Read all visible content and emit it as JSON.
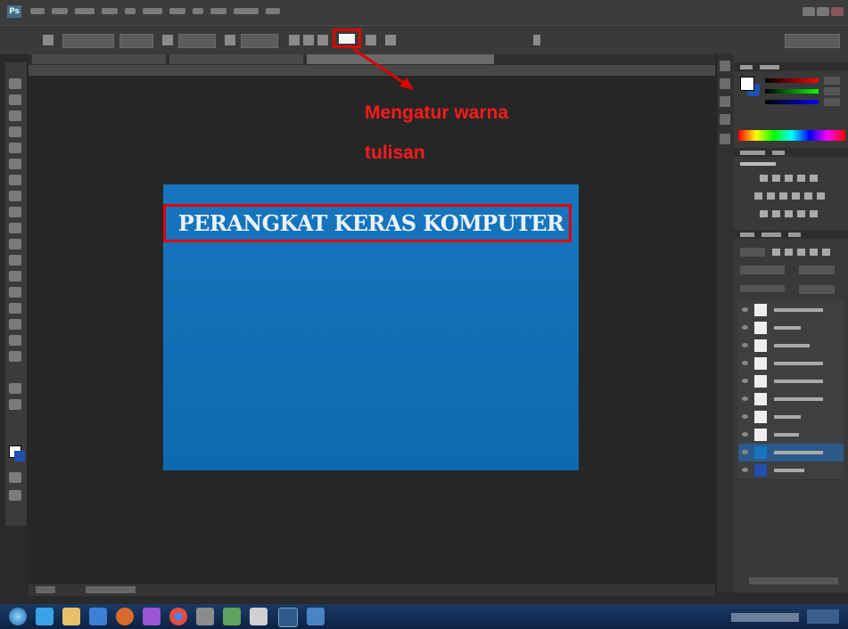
{
  "document": {
    "title_text": "PERANGKAT KERAS KOMPUTER",
    "background_color": "#1675bd",
    "text_color": "#e9f1ff"
  },
  "annotation": {
    "label": "Mengatur warna tulisan",
    "line1": "Mengatur warna",
    "line2": "tulisan",
    "color": "#ff1a1a",
    "target": "text-color-swatch"
  },
  "options_bar": {
    "text_color_swatch": "#f4f4f4"
  },
  "icons": {
    "app": "photoshop-icon",
    "taskbar": [
      "start-orb-icon",
      "internet-explorer-icon",
      "file-explorer-icon",
      "windows-media-player-icon",
      "firefox-icon",
      "app-icon",
      "chrome-icon",
      "app-icon",
      "app-icon",
      "app-icon",
      "photoshop-icon"
    ]
  }
}
